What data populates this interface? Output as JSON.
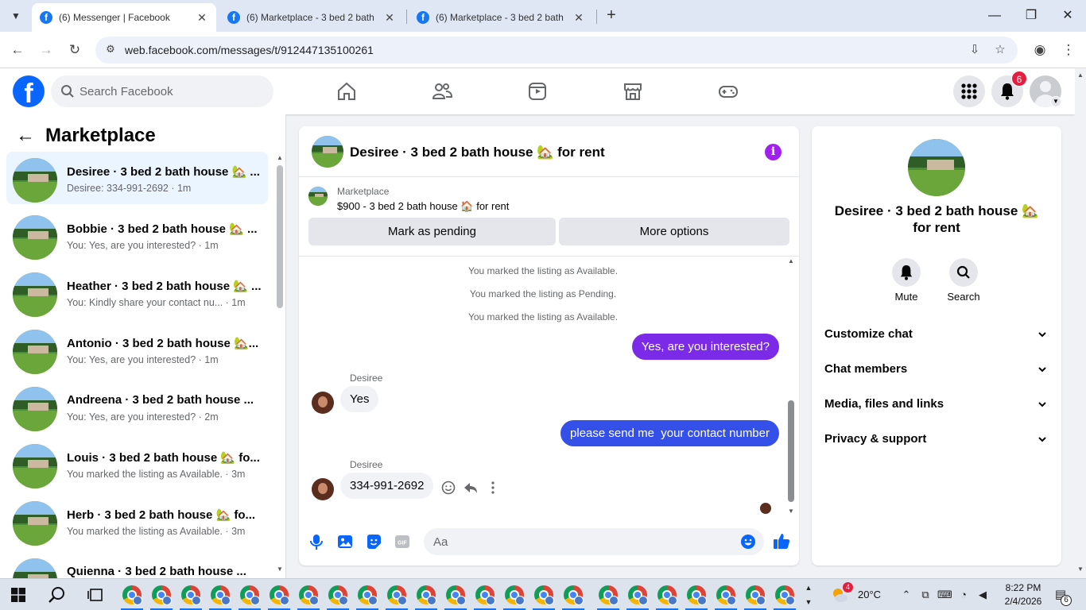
{
  "browser": {
    "tabs": [
      {
        "title": "(6) Messenger | Facebook",
        "favicon": "facebook-icon"
      },
      {
        "title": "(6) Marketplace - 3 bed 2 bath",
        "favicon": "facebook-icon"
      },
      {
        "title": "(6) Marketplace - 3 bed 2 bath",
        "favicon": "facebook-icon"
      }
    ],
    "favicon_letter": "f",
    "url": "web.facebook.com/messages/t/912447135100261"
  },
  "facebook": {
    "logo_letter": "f",
    "search_placeholder": "Search Facebook",
    "notifications_count": "6",
    "brand_color": "#0866ff"
  },
  "sidebar": {
    "title": "Marketplace",
    "conversations": [
      {
        "name": "Desiree · 3 bed 2 bath house 🏡 ...",
        "snippet": "Desiree: 334-991-2692 · 1m",
        "active": true
      },
      {
        "name": "Bobbie · 3 bed 2 bath house 🏡 ...",
        "snippet": "You: Yes, are you interested? · 1m"
      },
      {
        "name": "Heather · 3 bed 2 bath house 🏡 ...",
        "snippet": "You: Kindly share your contact nu... · 1m"
      },
      {
        "name": "Antonio · 3 bed 2 bath house 🏡...",
        "snippet": "You: Yes, are you interested? · 1m"
      },
      {
        "name": "Andreena · 3 bed 2 bath house ...",
        "snippet": "You: Yes, are you interested? · 2m"
      },
      {
        "name": "Louis · 3 bed 2 bath house 🏡 fo...",
        "snippet": "You marked the listing as Available. · 3m"
      },
      {
        "name": "Herb · 3 bed 2 bath house 🏡 fo...",
        "snippet": "You marked the listing as Available. · 3m"
      },
      {
        "name": "Quienna · 3 bed 2 bath house ...",
        "snippet": ""
      }
    ]
  },
  "chat": {
    "title": "Desiree · 3 bed 2 bath house 🏡 for rent",
    "marketplace_label": "Marketplace",
    "listing": "$900 - 3 bed 2 bath house 🏠 for rent",
    "mark_pending": "Mark as pending",
    "more_options": "More options",
    "system_messages": [
      "You marked the listing as Available.",
      "You marked the listing as Pending.",
      "You marked the listing as Available."
    ],
    "messages": [
      {
        "from": "me",
        "text": "Yes, are you interested?",
        "color": "#7b2be8"
      },
      {
        "sender": "Desiree",
        "from": "them",
        "text": "Yes"
      },
      {
        "from": "me",
        "text": "please send me  your contact number",
        "color": "#3450e8"
      },
      {
        "sender": "Desiree",
        "from": "them",
        "text": "334-991-2692"
      }
    ],
    "composer_placeholder": "Aa",
    "accent": "#0866ff"
  },
  "info_panel": {
    "name": "Desiree · 3 bed 2 bath house 🏡 for rent",
    "mute": "Mute",
    "search": "Search",
    "sections": [
      "Customize chat",
      "Chat members",
      "Media, files and links",
      "Privacy & support"
    ]
  },
  "taskbar": {
    "temperature": "20°C",
    "weather_badge": "4",
    "time": "8:22 PM",
    "date": "2/4/2026",
    "notification_count": "6"
  }
}
